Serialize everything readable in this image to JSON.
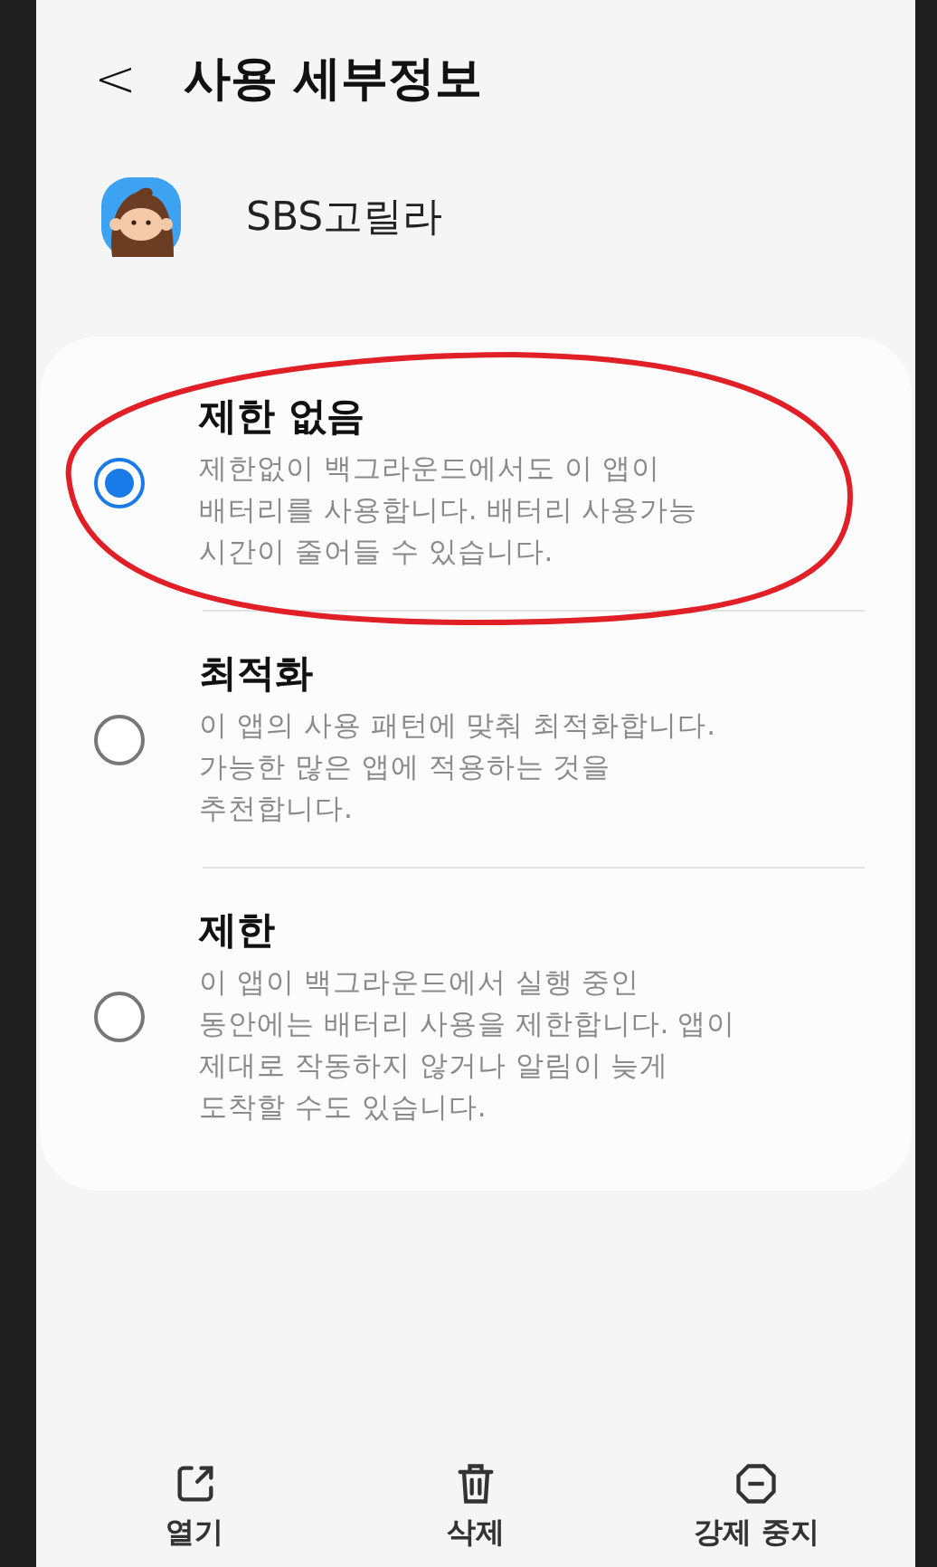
{
  "header": {
    "back": "<",
    "title": "사용 세부정보"
  },
  "app": {
    "name": "SBS고릴라"
  },
  "options": [
    {
      "title": "제한 없음",
      "description": "제한없이 백그라운드에서도 이 앱이 배터리를 사용합니다. 배터리 사용가능 시간이 줄어들 수 있습니다.",
      "selected": true,
      "circled": true
    },
    {
      "title": "최적화",
      "description": "이 앱의 사용 패턴에 맞춰 최적화합니다. 가능한 많은 앱에 적용하는 것을 추천합니다.",
      "selected": false,
      "circled": false
    },
    {
      "title": "제한",
      "description": "이 앱이 백그라운드에서 실행 중인 동안에는 배터리 사용을 제한합니다. 앱이 제대로 작동하지 않거나 알림이 늦게 도착할 수도 있습니다.",
      "selected": false,
      "circled": false
    }
  ],
  "actions": [
    {
      "kind": "open",
      "label": "열기"
    },
    {
      "kind": "delete",
      "label": "삭제"
    },
    {
      "kind": "stop",
      "label": "강제 중지"
    }
  ]
}
